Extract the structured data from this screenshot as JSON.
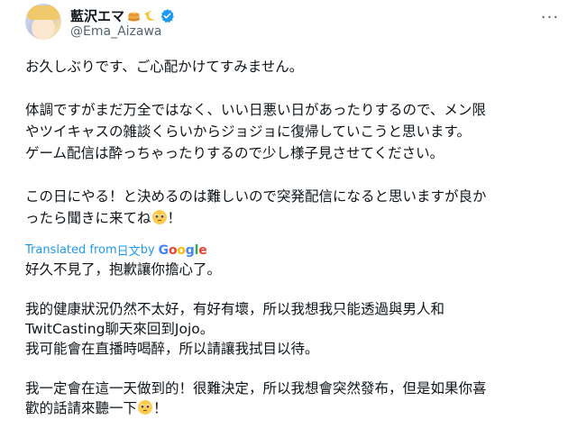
{
  "colors": {
    "accent": "#1d9bf0",
    "secondary_text": "#536471",
    "primary_text": "#0f1419"
  },
  "author": {
    "display_name": "藍沢エマ",
    "handle": "@Ema_Aizawa",
    "name_emojis": [
      "pancake-emoji",
      "sparkle-moon-emoji"
    ],
    "verified": true
  },
  "more_label": "···",
  "tweet": {
    "paragraphs": [
      [
        "お久しぶりです、ご心配かけてすみません。"
      ],
      [
        "体調ですがまだ万全ではなく、いい日悪い日があったりするので、メン限",
        "やツイキャスの雑談くらいからジョジョに復帰していこうと思います。",
        "ゲーム配信は酔っちゃったりするので少し様子見させてください。"
      ],
      [
        "この日にやる！と決めるのは難しいので突発配信になると思いますが良か",
        "ったら聞きに来てね",
        "！"
      ]
    ]
  },
  "translation_bar": {
    "prefix": "Translated from ",
    "source_language": "日文",
    "by": " by ",
    "provider_letters": [
      "G",
      "o",
      "o",
      "g",
      "l",
      "e"
    ]
  },
  "translation": {
    "paragraphs": [
      [
        "好久不見了，抱歉讓你擔心了。"
      ],
      [
        "我的健康狀況仍然不太好，有好有壞，所以我想我只能透過與男人和",
        "TwitCasting聊天來回到Jojo。",
        "我可能會在直播時喝醉，所以請讓我拭目以待。"
      ],
      [
        "我一定會在這一天做到的！很難決定，所以我想會突然發布，但是如果你喜",
        "歡的話請來聽一下",
        "！"
      ]
    ]
  }
}
